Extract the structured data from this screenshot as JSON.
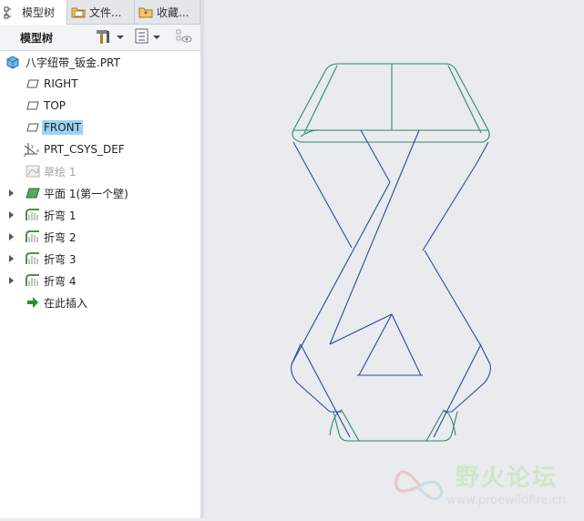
{
  "tabs": [
    {
      "label": "模型树",
      "icon": "model-tree-icon"
    },
    {
      "label": "文件...",
      "icon": "folder-icon"
    },
    {
      "label": "收藏...",
      "icon": "favorites-icon"
    }
  ],
  "toolbar": {
    "title": "模型树",
    "icons": [
      "settings-tools-icon",
      "tree-filter-icon",
      "show-hide-icon"
    ]
  },
  "tree": {
    "items": [
      {
        "label": "八字纽带_钣金.PRT",
        "icon": "part-icon",
        "expandable": false,
        "state": "normal"
      },
      {
        "label": "RIGHT",
        "icon": "datum-plane-icon",
        "expandable": false,
        "state": "normal"
      },
      {
        "label": "TOP",
        "icon": "datum-plane-icon",
        "expandable": false,
        "state": "normal"
      },
      {
        "label": "FRONT",
        "icon": "datum-plane-icon",
        "expandable": false,
        "state": "selected"
      },
      {
        "label": "PRT_CSYS_DEF",
        "icon": "coordinate-system-icon",
        "expandable": false,
        "state": "normal"
      },
      {
        "label": "草绘 1",
        "icon": "sketch-icon",
        "expandable": false,
        "state": "dimmed"
      },
      {
        "label": "平面 1(第一个壁)",
        "icon": "flat-wall-icon",
        "expandable": true,
        "state": "normal"
      },
      {
        "label": "折弯 1",
        "icon": "bend-icon",
        "expandable": true,
        "state": "normal"
      },
      {
        "label": "折弯 2",
        "icon": "bend-icon",
        "expandable": true,
        "state": "normal"
      },
      {
        "label": "折弯 3",
        "icon": "bend-icon",
        "expandable": true,
        "state": "normal"
      },
      {
        "label": "折弯 4",
        "icon": "bend-icon",
        "expandable": true,
        "state": "normal"
      },
      {
        "label": "在此插入",
        "icon": "insert-here-arrow-icon",
        "expandable": false,
        "state": "normal"
      }
    ]
  },
  "colors": {
    "edge_blue": "#2a4c9a",
    "edge_green": "#2d8a6e",
    "selection": "#99d4f5",
    "canvas": "#e9ebee"
  },
  "watermark": {
    "cn": "野火论坛",
    "url": "www.proewildfire.cn"
  }
}
